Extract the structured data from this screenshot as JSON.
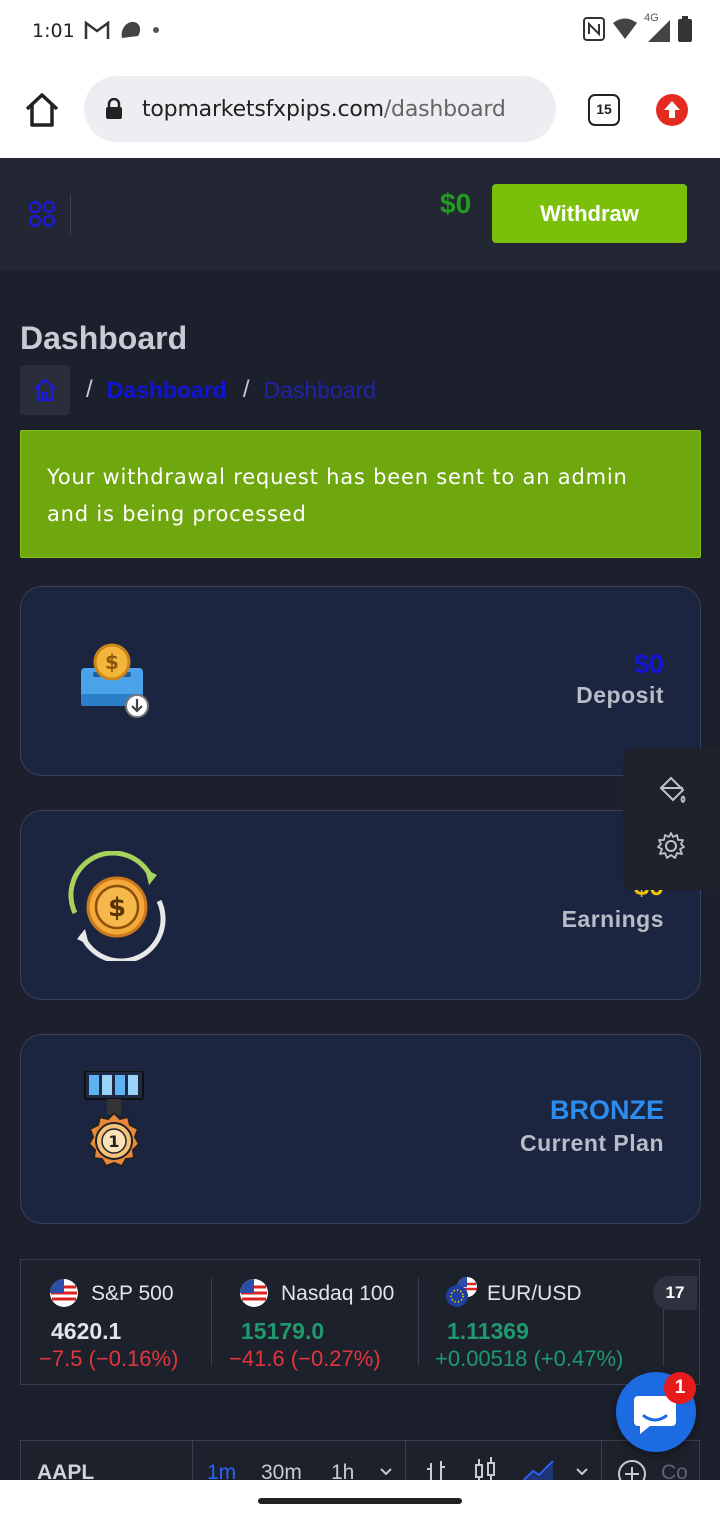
{
  "status_bar": {
    "time": "1:01",
    "network_label": "4G",
    "icons": [
      "gmail-icon",
      "notification-icon",
      "nfc-icon",
      "wifi-icon",
      "signal-icon",
      "battery-icon"
    ]
  },
  "browser": {
    "url_domain": "topmarketsfxpips.com",
    "url_path": "/dashboard",
    "tab_count": "15",
    "icons": [
      "home-icon",
      "lock-icon",
      "tabs-icon",
      "update-icon"
    ]
  },
  "header": {
    "balance": "$0",
    "withdraw_label": "Withdraw",
    "menu_icon": "grid-menu-icon"
  },
  "page": {
    "title": "Dashboard",
    "breadcrumb": {
      "separator": "/",
      "link": "Dashboard",
      "current": "Dashboard"
    }
  },
  "alert": {
    "message": "Your withdrawal request has been sent to an admin and is being processed"
  },
  "cards": [
    {
      "value": "$0",
      "label": "Deposit",
      "icon": "deposit-icon",
      "value_color": "#1414e0"
    },
    {
      "value": "$0",
      "label": "Earnings",
      "icon": "earnings-coin-icon",
      "value_color": "#f2c200"
    },
    {
      "value": "BRONZE",
      "label": "Current Plan",
      "icon": "medal-icon",
      "value_color": "#2d8cf0"
    }
  ],
  "ticker": [
    {
      "name": "S&P 500",
      "price": "4620.1",
      "change": "−7.5 (−0.16%)",
      "price_color": "#e2e4ea",
      "change_color": "#e0363f"
    },
    {
      "name": "Nasdaq 100",
      "price": "15179.0",
      "change": "−41.6 (−0.27%)",
      "price_color": "#1e9a6e",
      "change_color": "#e0363f"
    },
    {
      "name": "EUR/USD",
      "price": "1.11369",
      "change": "+0.00518 (+0.47%)",
      "price_color": "#1e9a6e",
      "change_color": "#1e9a6e"
    }
  ],
  "tradingview_badge": "17",
  "chart_toolbar": {
    "symbol": "AAPL",
    "timeframes": [
      "1m",
      "30m",
      "1h"
    ],
    "compare_label": "Co"
  },
  "chat": {
    "badge_count": "1"
  },
  "colors": {
    "background": "#1c1f2c",
    "header": "#232733",
    "accent_green": "#7abf0a",
    "card_bg": "#1b2540"
  }
}
